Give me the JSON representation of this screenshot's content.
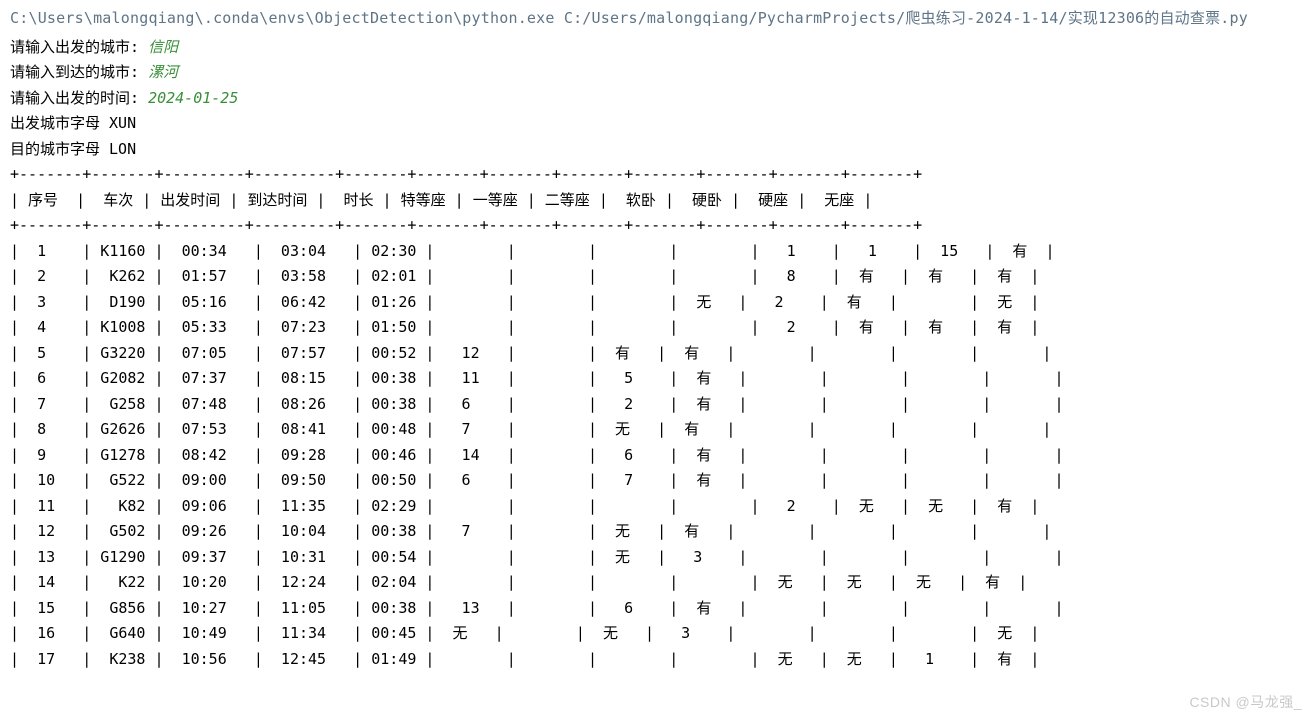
{
  "command": "C:\\Users\\malongqiang\\.conda\\envs\\ObjectDetection\\python.exe C:/Users/malongqiang/PycharmProjects/爬虫练习-2024-1-14/实现12306的自动查票.py",
  "prompts": {
    "depart_city_label": "请输入出发的城市: ",
    "depart_city_value": "信阳",
    "arrive_city_label": "请输入到达的城市: ",
    "arrive_city_value": "漯河",
    "date_label": "请输入出发的时间: ",
    "date_value": "2024-01-25"
  },
  "derived": {
    "depart_code_line": "出发城市字母  XUN",
    "arrive_code_line": "目的城市字母  LON"
  },
  "table": {
    "border_top": "+-------+-------+---------+---------+-------+-------+-------+-------+-------+-------+-------+-------+",
    "header_row": "| 序号  |  车次 | 出发时间 | 到达时间 |  时长 | 特等座 | 一等座 | 二等座 |  软卧 |  硬卧 |  硬座 |  无座 |",
    "header_sep": "+-------+-------+---------+---------+-------+-------+-------+-------+-------+-------+-------+-------+",
    "rows": [
      "|  1    | K1160 |  00:34   |  03:04   | 02:30 |        |        |        |        |   1    |   1    |  15   |  有  |",
      "|  2    |  K262 |  01:57   |  03:58   | 02:01 |        |        |        |        |   8    |  有   |  有   |  有  |",
      "|  3    |  D190 |  05:16   |  06:42   | 01:26 |        |        |        |  无   |   2    |  有   |        |  无  |",
      "|  4    | K1008 |  05:33   |  07:23   | 01:50 |        |        |        |        |   2    |  有   |  有   |  有  |",
      "|  5    | G3220 |  07:05   |  07:57   | 00:52 |   12   |        |  有   |  有   |        |        |        |       |",
      "|  6    | G2082 |  07:37   |  08:15   | 00:38 |   11   |        |   5    |  有   |        |        |        |       |",
      "|  7    |  G258 |  07:48   |  08:26   | 00:38 |   6    |        |   2    |  有   |        |        |        |       |",
      "|  8    | G2626 |  07:53   |  08:41   | 00:48 |   7    |        |  无   |  有   |        |        |        |       |",
      "|  9    | G1278 |  08:42   |  09:28   | 00:46 |   14   |        |   6    |  有   |        |        |        |       |",
      "|  10   |  G522 |  09:00   |  09:50   | 00:50 |   6    |        |   7    |  有   |        |        |        |       |",
      "|  11   |   K82 |  09:06   |  11:35   | 02:29 |        |        |        |        |   2    |  无   |  无   |  有  |",
      "|  12   |  G502 |  09:26   |  10:04   | 00:38 |   7    |        |  无   |  有   |        |        |        |       |",
      "|  13   | G1290 |  09:37   |  10:31   | 00:54 |        |        |  无   |   3    |        |        |        |       |",
      "|  14   |   K22 |  10:20   |  12:24   | 02:04 |        |        |        |        |  无   |  无   |  无   |  有  |",
      "|  15   |  G856 |  10:27   |  11:05   | 00:38 |   13   |        |   6    |  有   |        |        |        |       |",
      "|  16   |  G640 |  10:49   |  11:34   | 00:45 |  无   |        |  无   |   3    |        |        |        |  无  |",
      "|  17   |  K238 |  10:56   |  12:45   | 01:49 |        |        |        |        |  无   |  无   |   1    |  有  |"
    ]
  },
  "watermark": "CSDN @马龙强_"
}
